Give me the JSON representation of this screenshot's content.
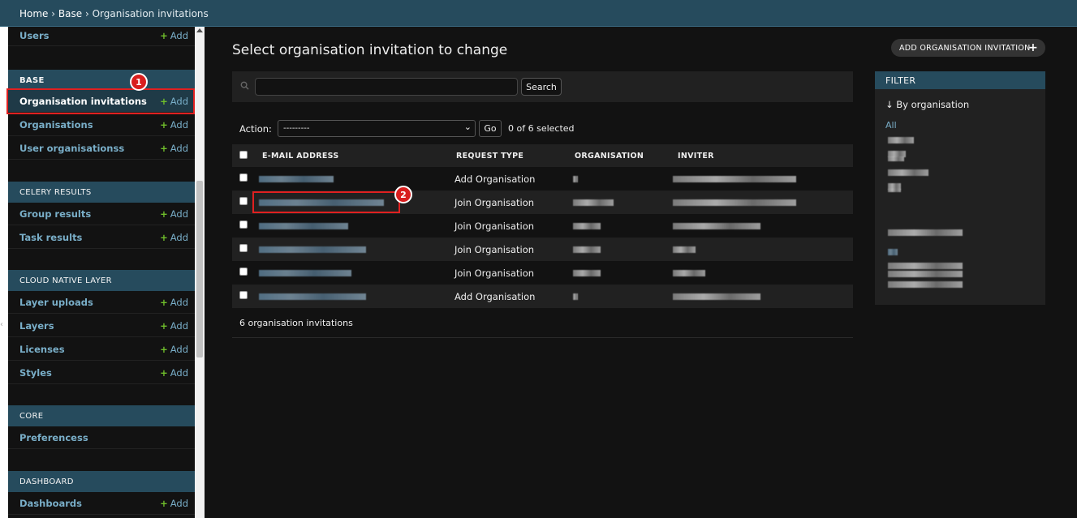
{
  "breadcrumbs": {
    "home": "Home",
    "app": "Base",
    "current": "Organisation invitations",
    "sep": "›"
  },
  "sidebar": {
    "top_item": {
      "label": "Users",
      "add": "Add"
    },
    "sections": [
      {
        "title": "BASE",
        "items": [
          {
            "label": "Organisation invitations",
            "add": "Add",
            "selected": true
          },
          {
            "label": "Organisations",
            "add": "Add"
          },
          {
            "label": "User organisationss",
            "add": "Add"
          }
        ]
      },
      {
        "title": "CELERY RESULTS",
        "items": [
          {
            "label": "Group results",
            "add": "Add"
          },
          {
            "label": "Task results",
            "add": "Add"
          }
        ]
      },
      {
        "title": "CLOUD NATIVE LAYER",
        "items": [
          {
            "label": "Layer uploads",
            "add": "Add"
          },
          {
            "label": "Layers",
            "add": "Add"
          },
          {
            "label": "Licenses",
            "add": "Add"
          },
          {
            "label": "Styles",
            "add": "Add"
          }
        ]
      },
      {
        "title": "CORE",
        "items": [
          {
            "label": "Preferencess"
          }
        ]
      },
      {
        "title": "DASHBOARD",
        "items": [
          {
            "label": "Dashboards",
            "add": "Add"
          }
        ]
      }
    ],
    "edge_glyph": "‹"
  },
  "main": {
    "title": "Select organisation invitation to change",
    "add_button": "ADD ORGANISATION INVITATION",
    "search": {
      "placeholder": "",
      "value": "",
      "button": "Search"
    },
    "actions": {
      "label": "Action:",
      "selected": "---------",
      "go": "Go",
      "count": "0 of 6 selected"
    },
    "columns": [
      "E-MAIL ADDRESS",
      "REQUEST TYPE",
      "ORGANISATION",
      "INVITER"
    ],
    "rows": [
      {
        "request_type": "Add Organisation"
      },
      {
        "request_type": "Join Organisation"
      },
      {
        "request_type": "Join Organisation"
      },
      {
        "request_type": "Join Organisation"
      },
      {
        "request_type": "Join Organisation"
      },
      {
        "request_type": "Add Organisation"
      }
    ],
    "result_count": "6 organisation invitations"
  },
  "filter": {
    "title": "FILTER",
    "by": "↓ By organisation",
    "all": "All"
  },
  "annotations": {
    "marker1": "1",
    "marker2": "2"
  },
  "colors": {
    "accent": "#264b5d",
    "link": "#79aec8",
    "add_plus": "#70bf2b",
    "marker": "#e02020",
    "background": "#121212"
  }
}
